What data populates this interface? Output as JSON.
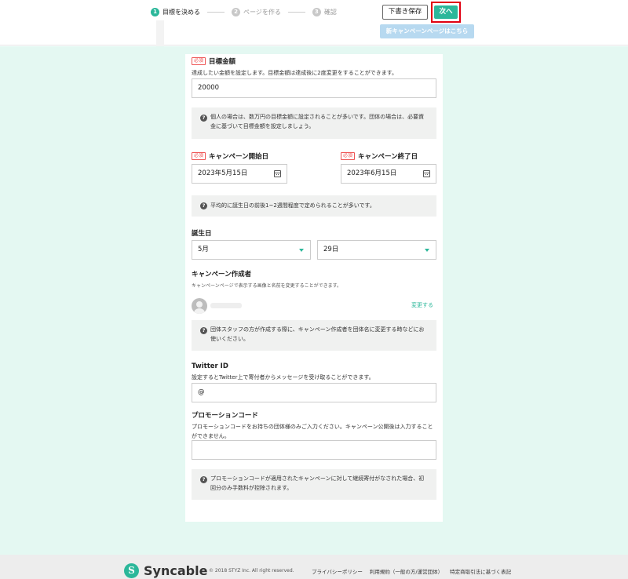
{
  "header": {
    "steps": [
      {
        "num": "1",
        "label": "目標を決める"
      },
      {
        "num": "2",
        "label": "ページを作る"
      },
      {
        "num": "3",
        "label": "確認"
      }
    ],
    "draft_label": "下書き保存",
    "next_label": "次へ",
    "new_page_label": "新キャンペーンページはこちら"
  },
  "goal": {
    "required": "必須",
    "label": "目標金額",
    "desc": "達成したい金額を設定します。目標金額は達成後に2度変更をすることができます。",
    "value": "20000",
    "info": "個人の場合は、数万円の目標金額に設定されることが多いです。団体の場合は、必要資金に基づいて目標金額を設定しましょう。"
  },
  "campaign_dates": {
    "start": {
      "required": "必須",
      "label": "キャンペーン開始日",
      "value": "2023年5月15日"
    },
    "end": {
      "required": "必須",
      "label": "キャンペーン終了日",
      "value": "2023年6月15日"
    },
    "info": "平均的に誕生日の前後1~2週間程度で定められることが多いです。"
  },
  "birthday": {
    "label": "誕生日",
    "month": "5月",
    "day": "29日"
  },
  "creator": {
    "label": "キャンペーン作成者",
    "desc": "キャンペーンページで表示する画像と名前を変更することができます。",
    "change_label": "変更する",
    "info": "団体スタッフの方が作成する際に、キャンペーン作成者を団体名に変更する時などにお使いください。"
  },
  "twitter": {
    "label": "Twitter ID",
    "desc": "設定するとTwitter上で寄付者からメッセージを受け取ることができます。",
    "value": "@"
  },
  "promo": {
    "label": "プロモーションコード",
    "desc": "プロモーションコードをお持ちの団体様のみご入力ください。キャンペーン公開後は入力することができません。",
    "value": "",
    "info": "プロモーションコードが適用されたキャンペーンに対して継続寄付がなされた場合、初回分のみ手数料が控除されます。"
  },
  "footer": {
    "logo_mark": "S",
    "logo_text": "Syncable",
    "copyright": "© 2018 STYZ Inc. All right reserved.",
    "links": [
      "プライバシーポリシー",
      "利用規約（一般の方/運営団体）",
      "特定商取引法に基づく表記"
    ]
  },
  "colors": {
    "accent": "#2bb79a",
    "highlight_border": "#e00012",
    "page_bg": "#e4f8f2",
    "new_page_button": "#b7d9f0"
  },
  "icons": [
    "calendar-icon",
    "help-icon",
    "caret-down-icon",
    "avatar-icon",
    "syncable-logo-icon"
  ]
}
